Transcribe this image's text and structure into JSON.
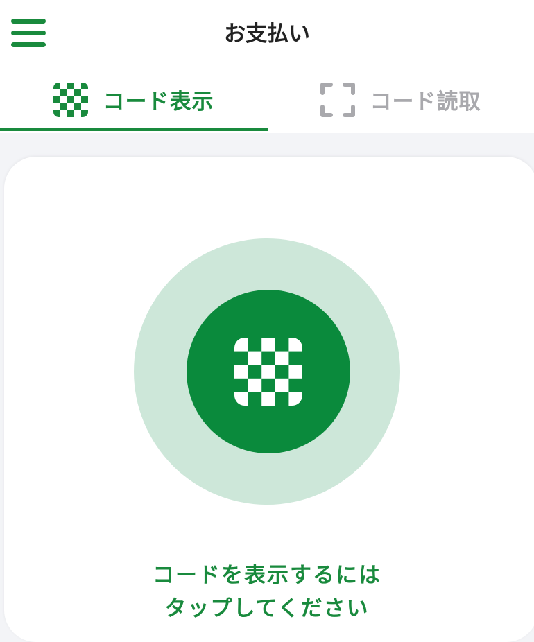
{
  "header": {
    "title": "お支払い",
    "menu_icon": "hamburger-menu-icon"
  },
  "tabs": [
    {
      "label": "コード表示",
      "icon": "code-display-icon",
      "selected": true
    },
    {
      "label": "コード読取",
      "icon": "scan-frame-icon",
      "selected": false
    }
  ],
  "main": {
    "display_button_icon": "code-display-icon",
    "instruction_line1": "コードを表示するには",
    "instruction_line2": "タップしてください"
  },
  "colors": {
    "brand_green": "#198a3d",
    "circle_outer": "#cde7d9",
    "circle_inner": "#0a8a3c",
    "inactive_gray": "#a9a9ad",
    "background": "#f3f4f7"
  }
}
